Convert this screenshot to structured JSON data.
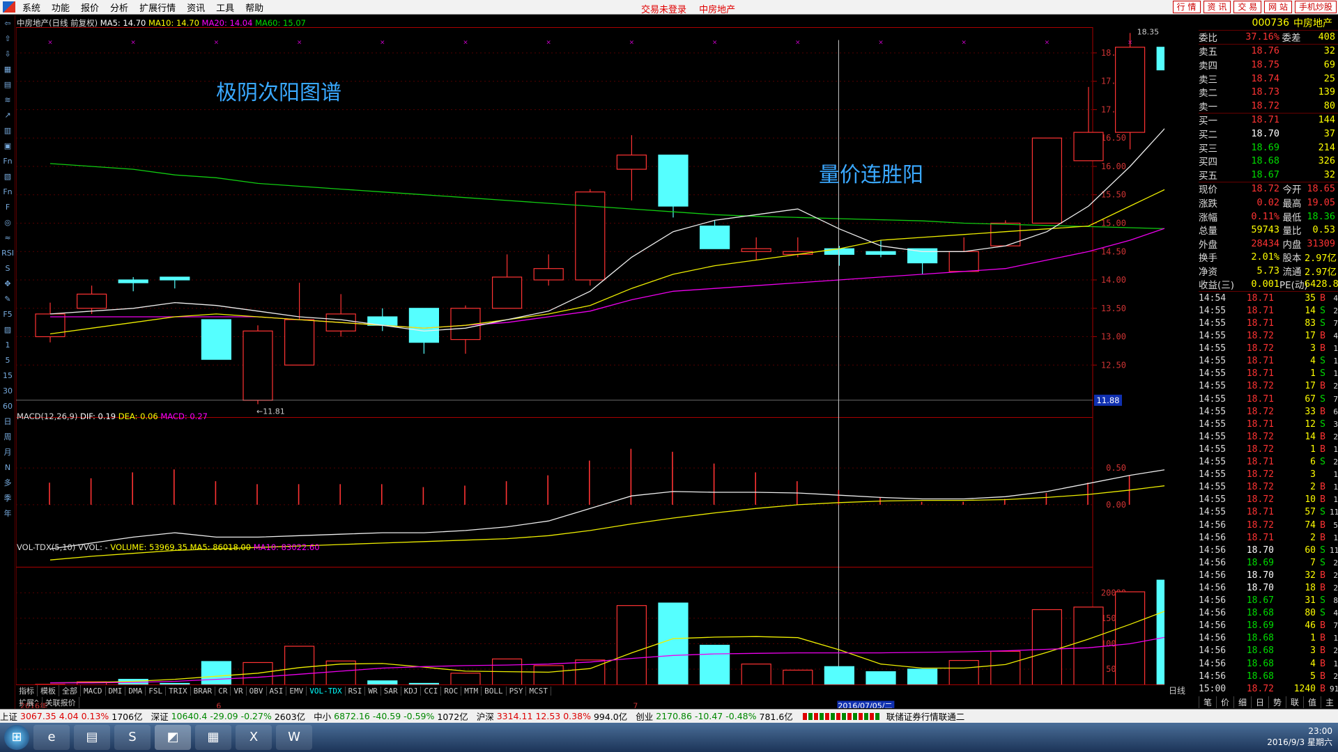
{
  "menu": [
    "系统",
    "功能",
    "报价",
    "分析",
    "扩展行情",
    "资讯",
    "工具",
    "帮助"
  ],
  "menu_center": [
    "交易未登录",
    "中房地产"
  ],
  "menu_right": [
    "行 情",
    "资 讯",
    "交 易",
    "网 站",
    "手机炒股"
  ],
  "header": {
    "name": "中房地产(日线 前复权)",
    "ma5": "MA5: 14.70",
    "ma10": "MA10: 14.70",
    "ma20": "MA20: 14.04",
    "ma60": "MA60: 15.07"
  },
  "annot1": "极阴次阳图谱",
  "annot2": "量价连胜阳",
  "hi_label": "18.35",
  "lo_label": "←11.81",
  "cur_price_tag": "11.88",
  "date_cursor": "2016/07/05/二",
  "year_label": "2016年",
  "month6": "6",
  "month7": "7",
  "xscale": "X10",
  "price_axis": [
    "18.00",
    "17.50",
    "17.00",
    "16.50",
    "16.00",
    "15.50",
    "15.00",
    "14.50",
    "14.00",
    "13.50",
    "13.00",
    "12.50"
  ],
  "macd_header": {
    "name": "MACD(12,26,9)",
    "dif": "DIF: 0.19",
    "dea": "DEA: 0.06",
    "macd": "MACD: 0.27"
  },
  "macd_axis": [
    "0.50",
    "0.00"
  ],
  "vol_header": {
    "name": "VOL-TDX(5,10)",
    "vvol": "VVOL: -",
    "volume": "VOLUME: 53969.35",
    "ma5": "MA5: 86018.00",
    "ma10": "MA10: 83022.60"
  },
  "vol_axis": [
    "20000",
    "15000",
    "10000",
    "5000"
  ],
  "period_label": "日线",
  "indicators": [
    "指标",
    "模板",
    "全部",
    "MACD",
    "DMI",
    "DMA",
    "FSL",
    "TRIX",
    "BRAR",
    "CR",
    "VR",
    "OBV",
    "ASI",
    "EMV",
    "VOL-TDX",
    "RSI",
    "WR",
    "SAR",
    "KDJ",
    "CCI",
    "ROC",
    "MTM",
    "BOLL",
    "PSY",
    "MCST"
  ],
  "ind2": [
    "扩展^",
    "关联报价"
  ],
  "lefttb": [
    "⇦",
    "⇧",
    "⇩",
    "▦",
    "▤",
    "≋",
    "↗",
    "▥",
    "▣",
    "Fn",
    "▧",
    "Fn",
    "F",
    "◎",
    "≈",
    "RSI",
    "S",
    "✥",
    "✎",
    "F5",
    "▨",
    "1",
    "5",
    "15",
    "30",
    "60",
    "日",
    "周",
    "月",
    "N",
    "多",
    "季",
    "年"
  ],
  "quote": {
    "code": "000736",
    "name": "中房地产",
    "wb_label": "委比",
    "wb": "37.16%",
    "wc_label": "委差",
    "wc": "408",
    "asks": [
      {
        "l": "卖五",
        "p": "18.76",
        "q": "32"
      },
      {
        "l": "卖四",
        "p": "18.75",
        "q": "69"
      },
      {
        "l": "卖三",
        "p": "18.74",
        "q": "25"
      },
      {
        "l": "卖二",
        "p": "18.73",
        "q": "139"
      },
      {
        "l": "卖一",
        "p": "18.72",
        "q": "80"
      }
    ],
    "bids": [
      {
        "l": "买一",
        "p": "18.71",
        "q": "144"
      },
      {
        "l": "买二",
        "p": "18.70",
        "q": "37"
      },
      {
        "l": "买三",
        "p": "18.69",
        "q": "214"
      },
      {
        "l": "买四",
        "p": "18.68",
        "q": "326"
      },
      {
        "l": "买五",
        "p": "18.67",
        "q": "32"
      }
    ],
    "stats": [
      [
        "现价",
        "18.72",
        "今开",
        "18.65"
      ],
      [
        "涨跌",
        "0.02",
        "最高",
        "19.05"
      ],
      [
        "涨幅",
        "0.11%",
        "最低",
        "18.36"
      ],
      [
        "总量",
        "59743",
        "量比",
        "0.53"
      ],
      [
        "外盘",
        "28434",
        "内盘",
        "31309"
      ],
      [
        "换手",
        "2.01%",
        "股本",
        "2.97亿"
      ],
      [
        "净资",
        "5.73",
        "流通",
        "2.97亿"
      ],
      [
        "收益(三)",
        "0.001",
        "PE(动)",
        "6428.8"
      ]
    ]
  },
  "ticks": [
    [
      "14:54",
      "18.71",
      "35",
      "B",
      "4"
    ],
    [
      "14:55",
      "18.71",
      "14",
      "S",
      "2"
    ],
    [
      "14:55",
      "18.71",
      "83",
      "S",
      "7"
    ],
    [
      "14:55",
      "18.72",
      "17",
      "B",
      "4"
    ],
    [
      "14:55",
      "18.72",
      "3",
      "B",
      "1"
    ],
    [
      "14:55",
      "18.71",
      "4",
      "S",
      "1"
    ],
    [
      "14:55",
      "18.71",
      "1",
      "S",
      "1"
    ],
    [
      "14:55",
      "18.72",
      "17",
      "B",
      "2"
    ],
    [
      "14:55",
      "18.71",
      "67",
      "S",
      "7"
    ],
    [
      "14:55",
      "18.72",
      "33",
      "B",
      "6"
    ],
    [
      "14:55",
      "18.71",
      "12",
      "S",
      "3"
    ],
    [
      "14:55",
      "18.72",
      "14",
      "B",
      "2"
    ],
    [
      "14:55",
      "18.72",
      "1",
      "B",
      "1"
    ],
    [
      "14:55",
      "18.71",
      "6",
      "S",
      "2"
    ],
    [
      "14:55",
      "18.72",
      "3",
      "",
      "1"
    ],
    [
      "14:55",
      "18.72",
      "2",
      "B",
      "1"
    ],
    [
      "14:55",
      "18.72",
      "10",
      "B",
      "1"
    ],
    [
      "14:55",
      "18.71",
      "57",
      "S",
      "11"
    ],
    [
      "14:56",
      "18.72",
      "74",
      "B",
      "5"
    ],
    [
      "14:56",
      "18.71",
      "2",
      "B",
      "1"
    ],
    [
      "14:56",
      "18.70",
      "60",
      "S",
      "11"
    ],
    [
      "14:56",
      "18.69",
      "7",
      "S",
      "2"
    ],
    [
      "14:56",
      "18.70",
      "32",
      "B",
      "2"
    ],
    [
      "14:56",
      "18.70",
      "18",
      "B",
      "2"
    ],
    [
      "14:56",
      "18.67",
      "31",
      "S",
      "8"
    ],
    [
      "14:56",
      "18.68",
      "80",
      "S",
      "4"
    ],
    [
      "14:56",
      "18.69",
      "46",
      "B",
      "7"
    ],
    [
      "14:56",
      "18.68",
      "1",
      "B",
      "1"
    ],
    [
      "14:56",
      "18.68",
      "3",
      "B",
      "2"
    ],
    [
      "14:56",
      "18.68",
      "4",
      "B",
      "1"
    ],
    [
      "14:56",
      "18.68",
      "5",
      "B",
      "2"
    ],
    [
      "15:00",
      "18.72",
      "1240",
      "B",
      "91"
    ]
  ],
  "right_tabs": [
    "笔",
    "价",
    "细",
    "日",
    "势",
    "联",
    "值",
    "主"
  ],
  "status": {
    "sh": "上证",
    "sh_v": "3067.35",
    "sh_c": "4.04",
    "sh_p": "0.13%",
    "sh_a": "1706亿",
    "sz": "深证",
    "sz_v": "10640.4",
    "sz_c": "-29.09",
    "sz_p": "-0.27%",
    "sz_a": "2603亿",
    "zx": "中小",
    "zx_v": "6872.16",
    "zx_c": "-40.59",
    "zx_p": "-0.59%",
    "zx_a": "1072亿",
    "hs": "沪深",
    "hs_v": "3314.11",
    "hs_c": "12.53",
    "hs_p": "0.38%",
    "hs_a": "994.0亿",
    "cy": "创业",
    "cy_v": "2170.86",
    "cy_c": "-10.47",
    "cy_p": "-0.48%",
    "cy_a": "781.6亿",
    "broker": "联储证券行情联通二"
  },
  "clock": {
    "time": "23:00",
    "date": "2016/9/3 星期六"
  },
  "chart_data": {
    "type": "candlestick",
    "candles": [
      {
        "o": 13.0,
        "h": 13.6,
        "l": 12.9,
        "c": 13.4
      },
      {
        "o": 13.5,
        "h": 13.9,
        "l": 13.4,
        "c": 13.75
      },
      {
        "o": 14.0,
        "h": 14.05,
        "l": 13.8,
        "c": 13.95
      },
      {
        "o": 14.05,
        "h": 14.05,
        "l": 13.85,
        "c": 14.0
      },
      {
        "o": 13.3,
        "h": 13.3,
        "l": 12.6,
        "c": 12.6
      },
      {
        "o": 11.88,
        "h": 13.2,
        "l": 11.81,
        "c": 13.1
      },
      {
        "o": 12.5,
        "h": 13.95,
        "l": 12.5,
        "c": 13.3
      },
      {
        "o": 13.1,
        "h": 13.75,
        "l": 13.0,
        "c": 13.4
      },
      {
        "o": 13.35,
        "h": 13.5,
        "l": 13.1,
        "c": 13.2
      },
      {
        "o": 13.5,
        "h": 13.5,
        "l": 12.7,
        "c": 12.9
      },
      {
        "o": 12.95,
        "h": 13.55,
        "l": 12.7,
        "c": 13.5
      },
      {
        "o": 13.5,
        "h": 14.45,
        "l": 13.5,
        "c": 14.05
      },
      {
        "o": 14.0,
        "h": 14.45,
        "l": 13.9,
        "c": 14.2
      },
      {
        "o": 14.0,
        "h": 15.6,
        "l": 13.9,
        "c": 15.55
      },
      {
        "o": 15.95,
        "h": 16.55,
        "l": 15.4,
        "c": 16.2
      },
      {
        "o": 16.2,
        "h": 16.2,
        "l": 15.1,
        "c": 15.3
      },
      {
        "o": 14.95,
        "h": 15.05,
        "l": 14.55,
        "c": 14.55
      },
      {
        "o": 14.5,
        "h": 14.75,
        "l": 14.35,
        "c": 14.55
      },
      {
        "o": 14.45,
        "h": 14.75,
        "l": 14.4,
        "c": 14.5
      },
      {
        "o": 14.55,
        "h": 14.6,
        "l": 14.25,
        "c": 14.45
      },
      {
        "o": 14.5,
        "h": 14.7,
        "l": 14.4,
        "c": 14.45
      },
      {
        "o": 14.55,
        "h": 14.55,
        "l": 14.1,
        "c": 14.3
      },
      {
        "o": 14.15,
        "h": 14.75,
        "l": 14.15,
        "c": 14.5
      },
      {
        "o": 14.6,
        "h": 15.05,
        "l": 14.6,
        "c": 15.0
      },
      {
        "o": 15.0,
        "h": 16.5,
        "l": 15.0,
        "c": 16.5
      },
      {
        "o": 16.1,
        "h": 17.4,
        "l": 16.1,
        "c": 16.6
      },
      {
        "o": 16.6,
        "h": 18.35,
        "l": 16.3,
        "c": 18.1
      },
      {
        "o": 18.1,
        "h": 18.35,
        "l": 17.1,
        "c": 17.7
      }
    ],
    "ma5": [
      13.4,
      13.45,
      13.5,
      13.6,
      13.55,
      13.45,
      13.35,
      13.3,
      13.2,
      13.1,
      13.15,
      13.3,
      13.45,
      13.8,
      14.4,
      14.85,
      15.05,
      15.15,
      15.25,
      14.9,
      14.6,
      14.5,
      14.5,
      14.6,
      14.85,
      15.3,
      16.0,
      16.8
    ],
    "ma10": [
      13.05,
      13.15,
      13.25,
      13.35,
      13.4,
      13.35,
      13.3,
      13.25,
      13.2,
      13.15,
      13.2,
      13.3,
      13.4,
      13.55,
      13.85,
      14.1,
      14.25,
      14.35,
      14.45,
      14.55,
      14.7,
      14.75,
      14.8,
      14.85,
      14.9,
      14.95,
      15.3,
      15.65
    ],
    "ma20": [
      13.35,
      13.35,
      13.35,
      13.35,
      13.35,
      13.35,
      13.3,
      13.25,
      13.2,
      13.15,
      13.2,
      13.25,
      13.35,
      13.45,
      13.65,
      13.8,
      13.85,
      13.9,
      13.95,
      14.0,
      14.05,
      14.1,
      14.15,
      14.2,
      14.35,
      14.5,
      14.7,
      14.95
    ],
    "ma60": [
      16.05,
      16.0,
      15.95,
      15.85,
      15.8,
      15.7,
      15.65,
      15.6,
      15.55,
      15.5,
      15.45,
      15.4,
      15.35,
      15.3,
      15.25,
      15.2,
      15.15,
      15.12,
      15.1,
      15.08,
      15.06,
      15.04,
      15.0,
      14.98,
      14.96,
      14.94,
      14.92,
      14.9
    ],
    "macd_dif": [
      -0.6,
      -0.52,
      -0.44,
      -0.38,
      -0.44,
      -0.44,
      -0.42,
      -0.4,
      -0.38,
      -0.38,
      -0.35,
      -0.3,
      -0.22,
      -0.05,
      0.12,
      0.18,
      0.17,
      0.17,
      0.16,
      0.13,
      0.1,
      0.08,
      0.08,
      0.11,
      0.18,
      0.29,
      0.4,
      0.49
    ],
    "macd_dea": [
      -0.75,
      -0.7,
      -0.66,
      -0.62,
      -0.6,
      -0.58,
      -0.56,
      -0.54,
      -0.52,
      -0.5,
      -0.48,
      -0.46,
      -0.42,
      -0.35,
      -0.26,
      -0.18,
      -0.11,
      -0.05,
      0.0,
      0.03,
      0.05,
      0.06,
      0.06,
      0.07,
      0.1,
      0.14,
      0.2,
      0.27
    ],
    "macd_hist": [
      0.3,
      0.36,
      0.44,
      0.48,
      0.32,
      0.28,
      0.28,
      0.28,
      0.28,
      0.24,
      0.26,
      0.32,
      0.4,
      0.6,
      0.76,
      0.72,
      0.56,
      0.44,
      0.32,
      0.2,
      0.1,
      0.04,
      0.04,
      0.08,
      0.16,
      0.3,
      0.4,
      0.44
    ],
    "volume": [
      2000,
      2500,
      3000,
      2200,
      6500,
      6300,
      9500,
      6600,
      2700,
      2200,
      4200,
      7000,
      5700,
      6800,
      17500,
      18000,
      9700,
      6000,
      4800,
      5500,
      4500,
      5000,
      6700,
      8500,
      16700,
      17200,
      20200,
      22500
    ],
    "vol_ma5": [
      2300,
      2400,
      2600,
      3000,
      3600,
      4200,
      5300,
      6000,
      6100,
      5400,
      4600,
      4500,
      4400,
      5100,
      8200,
      11000,
      11300,
      11400,
      11200,
      8800,
      6000,
      5200,
      5200,
      5900,
      8300,
      10900,
      13800,
      16900
    ],
    "vol_ma10": [
      2300,
      2300,
      2400,
      2600,
      3000,
      3400,
      4000,
      4600,
      5200,
      5500,
      5700,
      5800,
      6000,
      6400,
      7100,
      7700,
      8000,
      8100,
      8200,
      8200,
      8200,
      8300,
      8400,
      8600,
      8900,
      9200,
      10000,
      11500
    ],
    "price_range": [
      11.7,
      18.3
    ],
    "macd_range": [
      -0.8,
      0.95
    ],
    "vol_range": [
      0,
      23000
    ]
  }
}
